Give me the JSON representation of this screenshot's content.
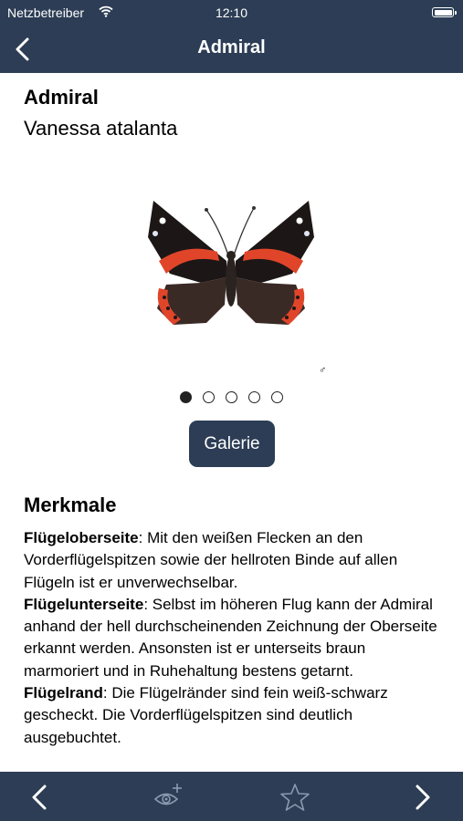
{
  "status_bar": {
    "carrier": "Netzbetreiber",
    "time": "12:10",
    "icons": [
      "wifi-icon",
      "battery-icon"
    ]
  },
  "nav_bar": {
    "title": "Admiral",
    "back_icon": "chevron-left-icon"
  },
  "species": {
    "name": "Admiral",
    "latin_name": "Vanessa atalanta",
    "sex_symbol": "♂"
  },
  "carousel": {
    "page_count": 5,
    "active_index": 0
  },
  "gallery_button": {
    "label": "Galerie"
  },
  "features": {
    "heading": "Merkmale",
    "items": [
      {
        "term": "Flügeloberseite",
        "text": ": Mit den weißen Flecken an den Vorderflügelspitzen sowie der hellroten Binde auf allen Flügeln ist er unverwechselbar."
      },
      {
        "term": "Flügelunterseite",
        "text": ": Selbst im höheren Flug kann der Admiral anhand der hell durchscheinenden Zeichnung der Oberseite erkannt werden. Ansonsten ist er unterseits braun marmoriert und in Ruhehaltung bestens getarnt."
      },
      {
        "term": "Flügelrand",
        "text": ": Die Flügelränder sind fein weiß-schwarz gescheckt. Die Vorderflügelspitzen sind deutlich ausgebuchtet."
      }
    ]
  },
  "toolbar": {
    "icons": [
      "previous-icon",
      "eye-plus-icon",
      "star-icon",
      "next-icon"
    ]
  },
  "colors": {
    "bar_background": "#2c3d55",
    "bar_foreground": "#ffffff",
    "butterfly_band": "#e0452a"
  }
}
